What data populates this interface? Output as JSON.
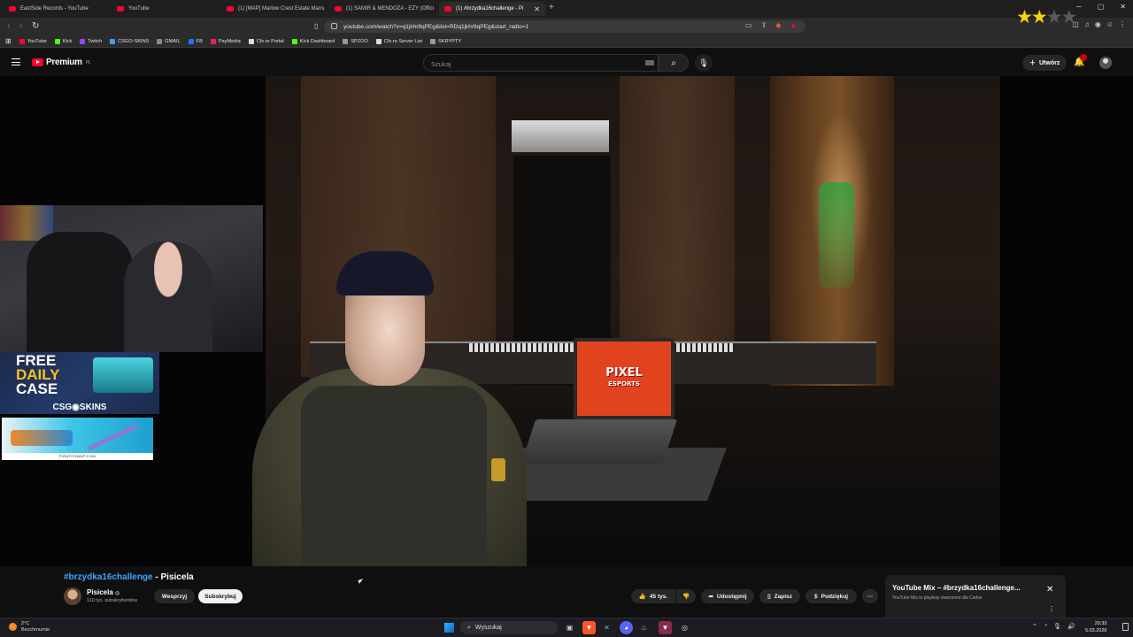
{
  "browser": {
    "tabs": [
      {
        "title": "EastSide Records - YouTube"
      },
      {
        "title": "YouTube"
      },
      {
        "title": "(1) [MAP] Marlow Crest Estate Mans"
      },
      {
        "title": "(1) SAMIR & MENDOZA - EZY (Offici"
      },
      {
        "title": "(1) #brzydka16challenge - Pi"
      }
    ],
    "new_tab": "+",
    "url": "youtube.com/watch?v=q1jkhr8qPEg&list=RDq1jkhr8qPEg&start_radio=1",
    "bookmarks": [
      {
        "label": "YouTube",
        "color": "#ff0033"
      },
      {
        "label": "Kick",
        "color": "#53fc18"
      },
      {
        "label": "Twitch",
        "color": "#9146ff"
      },
      {
        "label": "CSGO-SKINS",
        "color": "#3aa0ff"
      },
      {
        "label": "GMAIL",
        "color": "#888888"
      },
      {
        "label": "FB",
        "color": "#1877f2"
      },
      {
        "label": "PayMedia",
        "color": "#e0245e"
      },
      {
        "label": "Cfx.re Portal",
        "color": "#dddddd"
      },
      {
        "label": "Kick Dashboard",
        "color": "#53fc18"
      },
      {
        "label": "SPZOO",
        "color": "#999999"
      },
      {
        "label": "Cfx.re Server List",
        "color": "#dddddd"
      },
      {
        "label": "SKRYPTY",
        "color": "#999999"
      }
    ]
  },
  "youtube": {
    "logo_text": "Premium",
    "logo_region": "PL",
    "search_placeholder": "Szukaj",
    "create_label": "Utwórz",
    "notifications_badge": "",
    "video": {
      "title_hashtag": "#brzydka16challenge",
      "title_rest": " - Pisicela",
      "channel_name": "Pisicela",
      "verified": "◎",
      "subscribers": "110 tys. subskrybentów",
      "support_label": "Wesprzyj",
      "subscribe_label": "Subskrybuj",
      "likes": "45 tys.",
      "share_label": "Udostępnij",
      "save_label": "Zapisz",
      "thanks_label": "Podziękuj",
      "more": "···"
    },
    "overlay": {
      "laptop_logo_line1": "PIXEL",
      "laptop_logo_line2": "ESPORTS",
      "ad1_line1": "FREE",
      "ad1_line2": "DAILY",
      "ad1_line3": "CASE",
      "ad1_brand": "CSG◉SKINS",
      "ad2_site": "PIRATESWAP.COM"
    },
    "mix": {
      "title": "YouTube Mix – #brzydka16challenge...",
      "subtitle": "YouTube Mix to playlisty stworzone dla Ciebie",
      "close": "✕",
      "more": "⋮"
    }
  },
  "taskbar": {
    "weather_temp": "2°C",
    "weather_desc": "Bezchmurnie",
    "search_label": "Wyszukaj",
    "time": "20:33",
    "date": "5.03.2026"
  },
  "colors": {
    "accent_red": "#ff0033",
    "link_blue": "#3ea6ff",
    "star_gold": "#f8d40a"
  }
}
